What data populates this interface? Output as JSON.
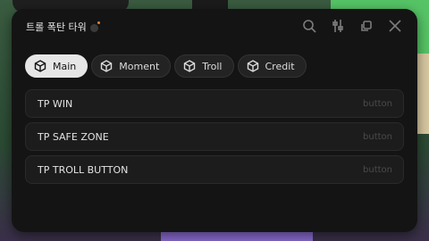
{
  "window": {
    "title": "트롤 폭탄 타워",
    "icons": [
      "search-icon",
      "settings-sliders-icon",
      "copy-icon",
      "close-icon"
    ]
  },
  "tabs": [
    {
      "label": "Main",
      "icon": "box-icon",
      "active": true
    },
    {
      "label": "Moment",
      "icon": "box-icon",
      "active": false
    },
    {
      "label": "Troll",
      "icon": "box-icon",
      "active": false
    },
    {
      "label": "Credit",
      "icon": "box-icon",
      "active": false
    }
  ],
  "items": [
    {
      "label": "TP WIN",
      "type": "button"
    },
    {
      "label": "TP SAFE ZONE",
      "type": "button"
    },
    {
      "label": "TP TROLL BUTTON",
      "type": "button"
    }
  ],
  "colors": {
    "panel_bg": "#141414",
    "tab_active_bg": "#e6e6e6",
    "row_bg": "#1c1c1c",
    "muted_text": "#4a4a4a"
  }
}
